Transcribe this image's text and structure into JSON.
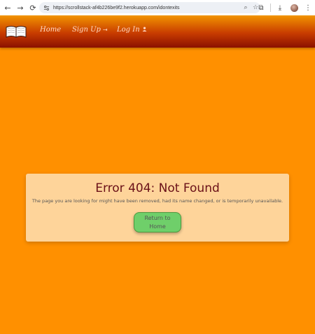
{
  "browser": {
    "url": "https://scrollstack-af4b226be9f2.herokuapp.com/idontexits",
    "back_glyph": "←",
    "forward_glyph": "→",
    "reload_glyph": "⟳",
    "zoom_glyph": "⌕",
    "bookmark_glyph": "☆",
    "extensions_glyph": "⧉",
    "download_glyph": "⤓",
    "menu_glyph": "⋮"
  },
  "site": {
    "nav": [
      {
        "label": "Home",
        "icon": ""
      },
      {
        "label": "Sign Up",
        "icon": "⇥"
      },
      {
        "label": "Log In",
        "icon": "●"
      }
    ],
    "logo_icon": "open-book-icon"
  },
  "error": {
    "title": "Error 404: Not Found",
    "message": "The page you are looking for might have been removed, had its name changed, or is temporarily unavailable.",
    "button_label": "Return to Home"
  },
  "colors": {
    "page_background": "#ff9000",
    "header_gradient_top": "#f29400",
    "header_gradient_bottom": "#8a1000",
    "card_background": "#fed49a",
    "title_color": "#6a1018",
    "button_background": "#6fcf6a"
  }
}
